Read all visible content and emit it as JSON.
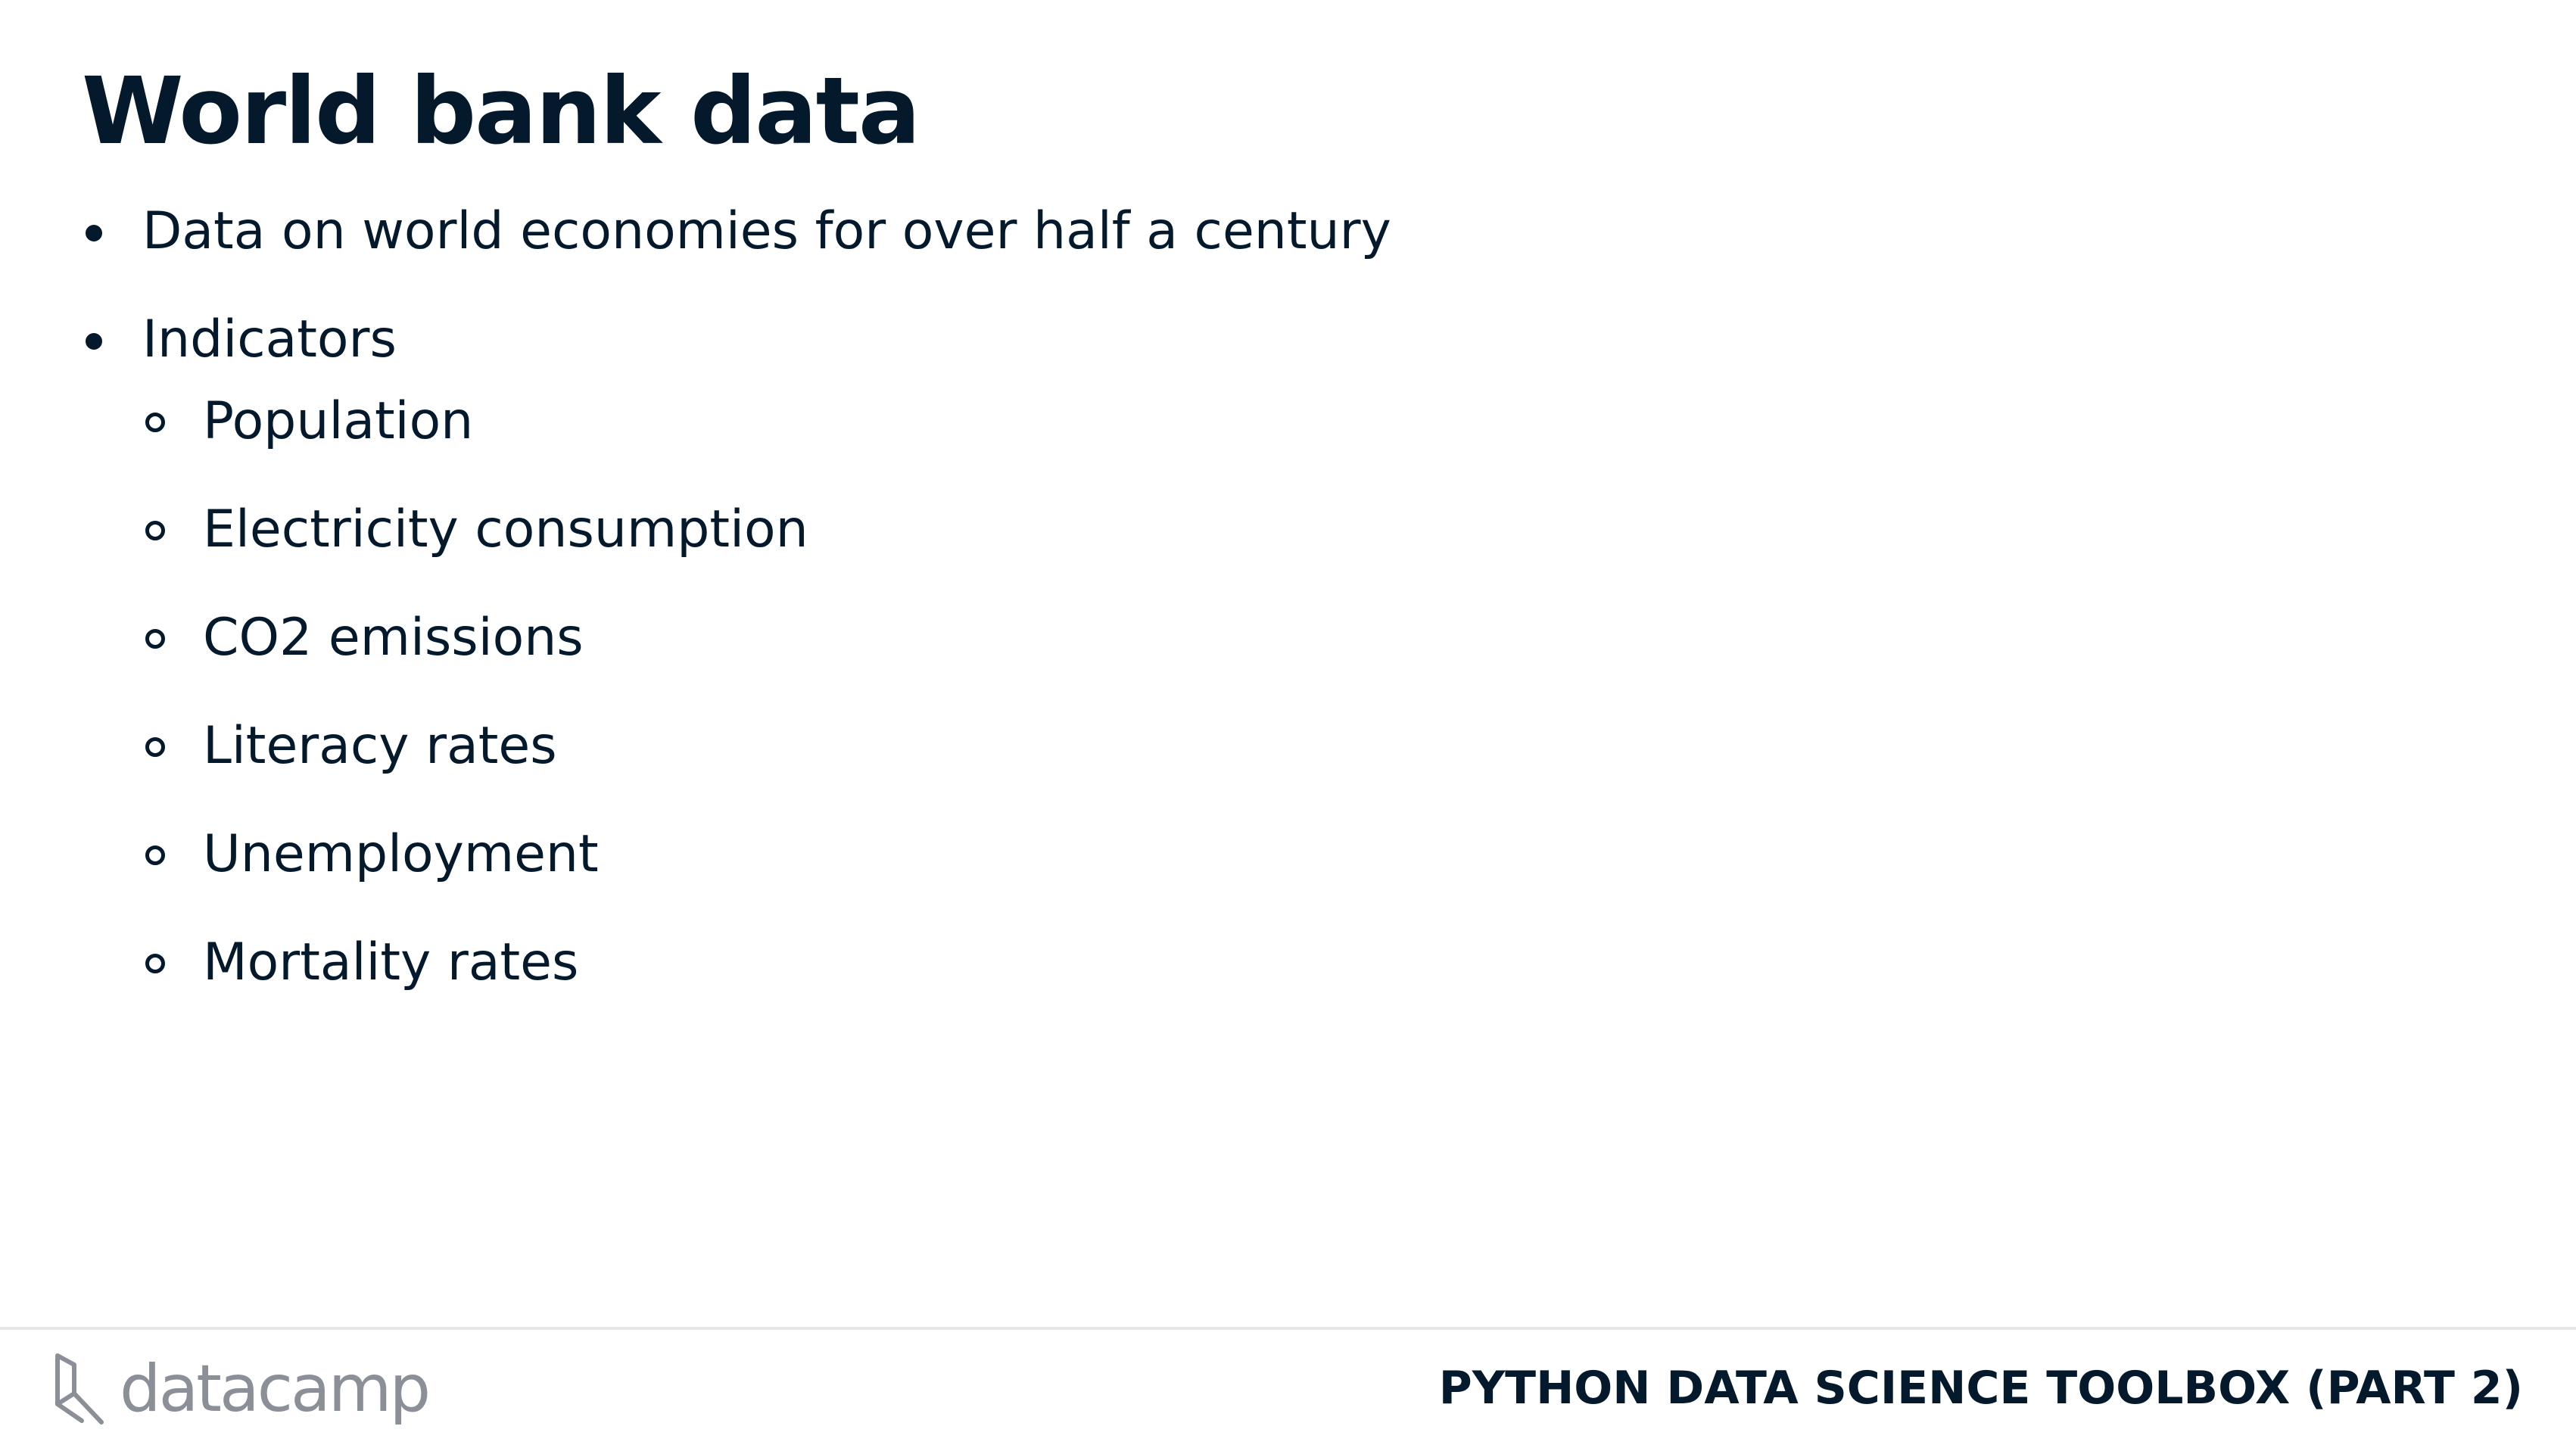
{
  "slide": {
    "title": "World bank data",
    "bullets": [
      {
        "label": "Data on world economies for over half a century"
      },
      {
        "label": "Indicators"
      }
    ],
    "sub_bullets": [
      {
        "label": "Population"
      },
      {
        "label": "Electricity consumption"
      },
      {
        "label": "CO2 emissions"
      },
      {
        "label": "Literacy rates"
      },
      {
        "label": "Unemployment"
      },
      {
        "label": "Mortality rates"
      }
    ]
  },
  "footer": {
    "logo_text": "datacamp",
    "logo_icon": "datacamp-logo-icon",
    "course_title": "PYTHON DATA SCIENCE TOOLBOX (PART 2)"
  },
  "colors": {
    "text": "#05192d",
    "logo_gray": "#8b8f97",
    "divider": "#e5e6e8"
  }
}
